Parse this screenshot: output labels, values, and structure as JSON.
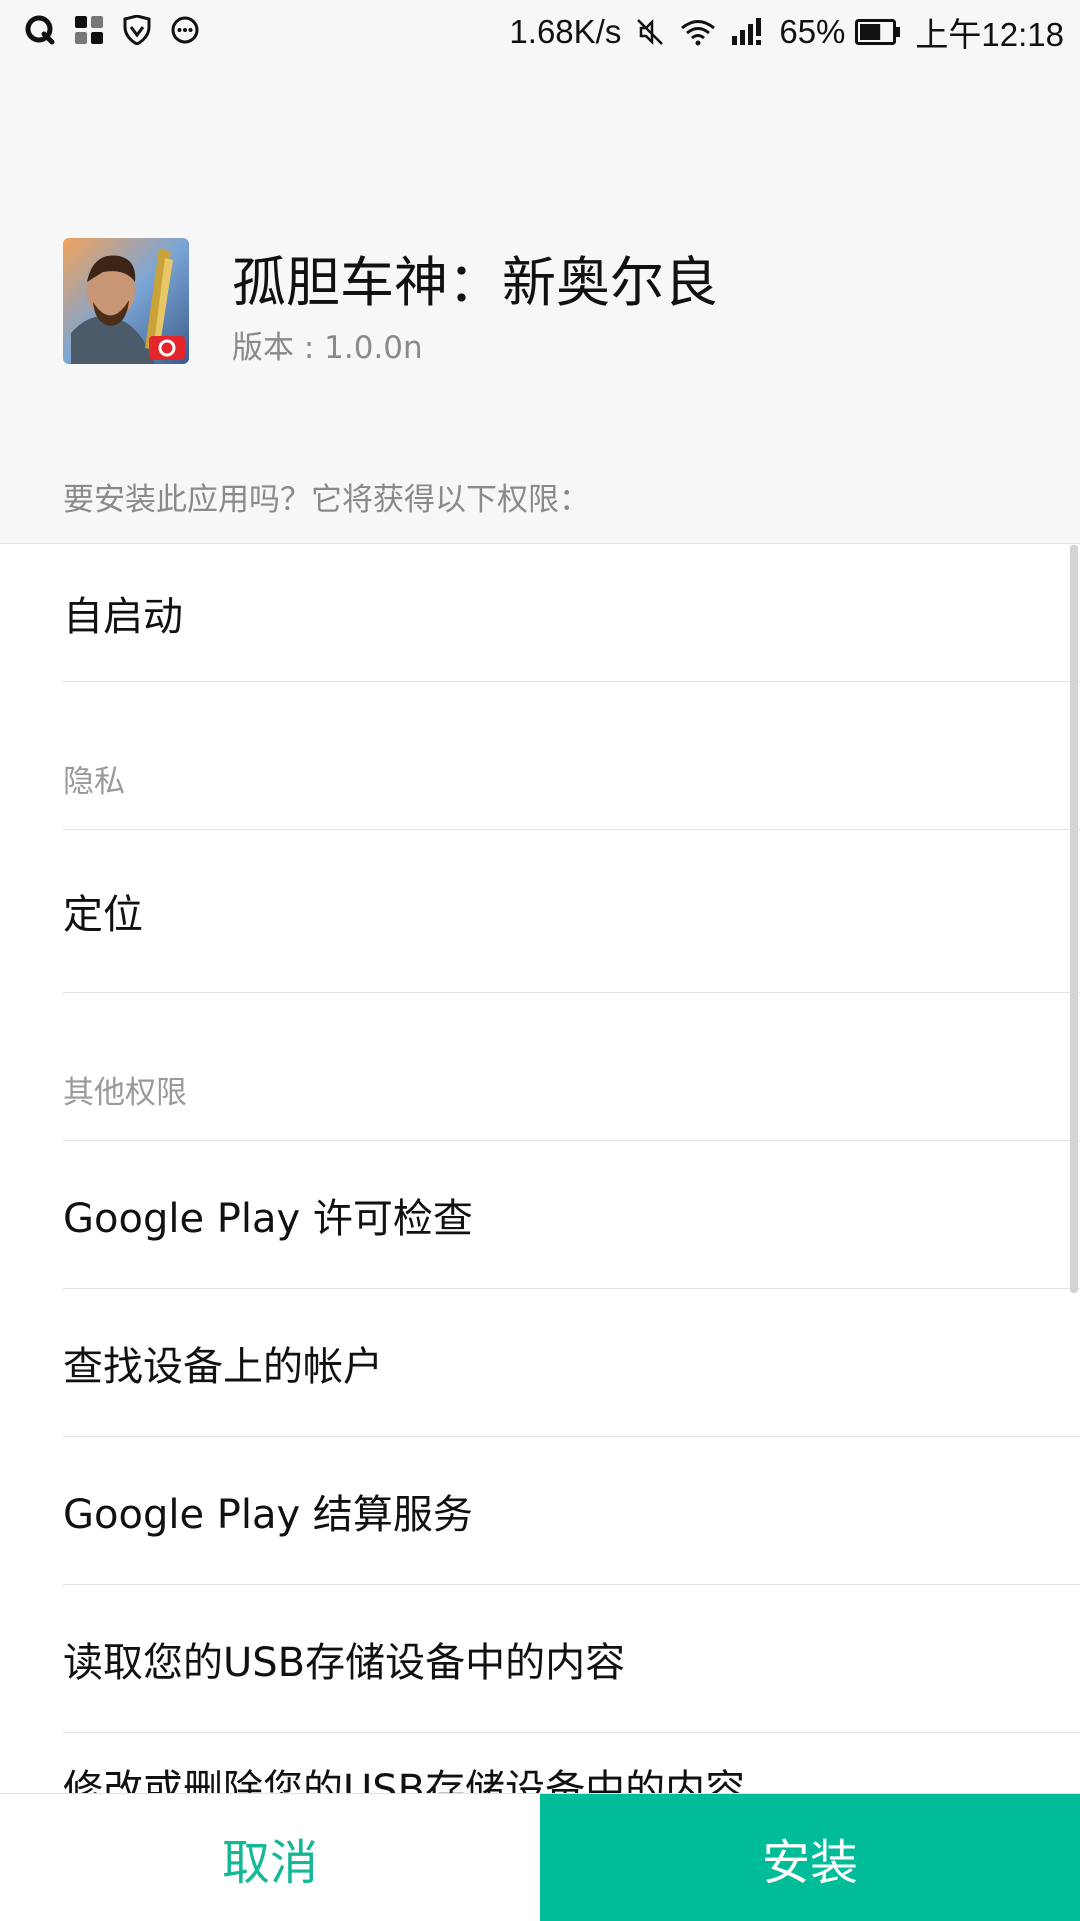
{
  "status_bar": {
    "left_icons": [
      "qq-icon",
      "apps-grid-icon",
      "shield-icon",
      "chat-bubble-icon"
    ],
    "network_speed": "1.68K/s",
    "battery_percent": "65%",
    "battery_level": 0.65,
    "time": "上午12:18"
  },
  "app": {
    "name": "孤胆车神：新奥尔良",
    "version": "版本 : 1.0.0n"
  },
  "prompt": "要安装此应用吗？它将获得以下权限：",
  "permissions": {
    "item_autostart": "自启动",
    "section_privacy": "隐私",
    "item_location": "定位",
    "section_other": "其他权限",
    "item_license": "Google Play 许可检查",
    "item_accounts": "查找设备上的帐户",
    "item_billing": "Google Play 结算服务",
    "item_usb_read": "读取您的USB存储设备中的内容",
    "item_usb_modify": "修改或删除您的USB存储设备中的内容"
  },
  "buttons": {
    "cancel": "取消",
    "install": "安装"
  },
  "colors": {
    "accent": "#00bc98",
    "cancel_text": "#14b896"
  }
}
